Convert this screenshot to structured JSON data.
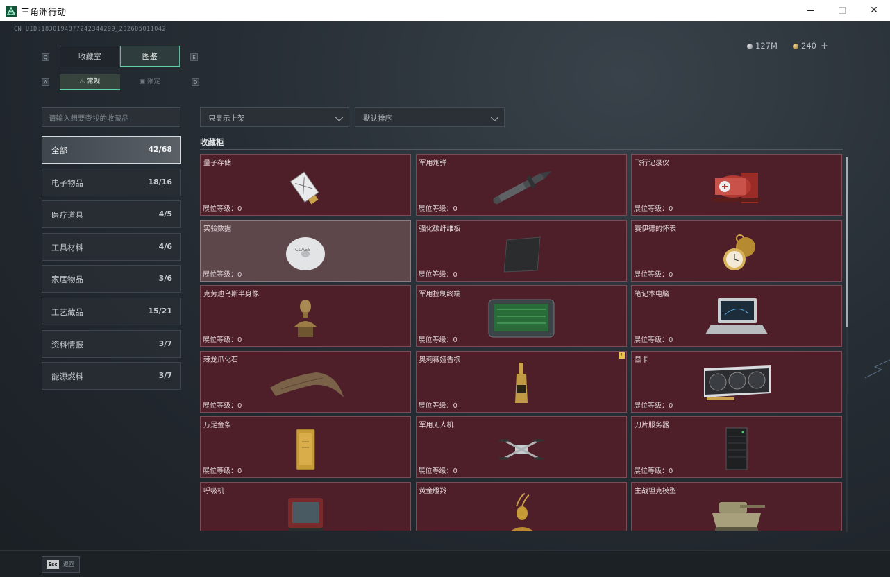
{
  "window": {
    "title": "三角洲行动"
  },
  "uid": "CN UID:1830194877242344299_2026050110​42",
  "currency": [
    {
      "icon": "silver-coin-icon",
      "value": "127M"
    },
    {
      "icon": "gold-coin-icon",
      "value": "240"
    }
  ],
  "currency_plus": "+",
  "keys": {
    "q": "Q",
    "e": "E",
    "a": "A",
    "d": "D"
  },
  "tabs": [
    {
      "label": "收藏室",
      "active": false
    },
    {
      "label": "图鉴",
      "active": true
    }
  ],
  "subtabs": [
    {
      "label": "常规",
      "icon": "flame-icon",
      "active": true
    },
    {
      "label": "限定",
      "icon": "box-icon",
      "active": false
    }
  ],
  "search": {
    "placeholder": "请输入想要查找的收藏品"
  },
  "filters": [
    {
      "label": "只显示上架"
    },
    {
      "label": "默认排序"
    }
  ],
  "categories": [
    {
      "name": "全部",
      "count": "42/68",
      "active": true
    },
    {
      "name": "电子物品",
      "count": "18/16",
      "active": false
    },
    {
      "name": "医疗道具",
      "count": "4/5",
      "active": false
    },
    {
      "name": "工具材料",
      "count": "4/6",
      "active": false
    },
    {
      "name": "家居物品",
      "count": "3/6",
      "active": false
    },
    {
      "name": "工艺藏品",
      "count": "15/21",
      "active": false
    },
    {
      "name": "资料情报",
      "count": "3/7",
      "active": false
    },
    {
      "name": "能源燃料",
      "count": "3/7",
      "active": false
    }
  ],
  "cabinet": {
    "title": "收藏柜",
    "level_label": "展位等级：",
    "items": [
      {
        "name": "量子存储",
        "level": "0",
        "art": "usb"
      },
      {
        "name": "军用炮弹",
        "level": "0",
        "art": "shell"
      },
      {
        "name": "飞行记录仪",
        "level": "0",
        "art": "recorder"
      },
      {
        "name": "实验数据",
        "level": "0",
        "art": "disc",
        "highlight": true
      },
      {
        "name": "强化碳纤维板",
        "level": "0",
        "art": "plate"
      },
      {
        "name": "赛伊德的怀表",
        "level": "0",
        "art": "watch"
      },
      {
        "name": "克劳迪乌斯半身像",
        "level": "0",
        "art": "bust"
      },
      {
        "name": "军用控制终端",
        "level": "0",
        "art": "terminal"
      },
      {
        "name": "笔记本电脑",
        "level": "0",
        "art": "laptop"
      },
      {
        "name": "棘龙爪化石",
        "level": "0",
        "art": "claw"
      },
      {
        "name": "奥莉薇娅香槟",
        "level": "0",
        "art": "bottle",
        "badge": "!"
      },
      {
        "name": "显卡",
        "level": "0",
        "art": "gpu"
      },
      {
        "name": "万足金条",
        "level": "0",
        "art": "goldbar"
      },
      {
        "name": "军用无人机",
        "level": "0",
        "art": "drone"
      },
      {
        "name": "刀片服务器",
        "level": "0",
        "art": "server"
      },
      {
        "name": "呼吸机",
        "level": "",
        "art": "ventilator"
      },
      {
        "name": "黄金瞪羚",
        "level": "",
        "art": "gazelle"
      },
      {
        "name": "主战坦克模型",
        "level": "",
        "art": "tank"
      }
    ]
  },
  "esc": {
    "key": "Esc",
    "label": "返回"
  },
  "colors": {
    "accent": "#5fd0a8",
    "card_bg": "#4e1f29",
    "card_border": "#7a4c55"
  }
}
